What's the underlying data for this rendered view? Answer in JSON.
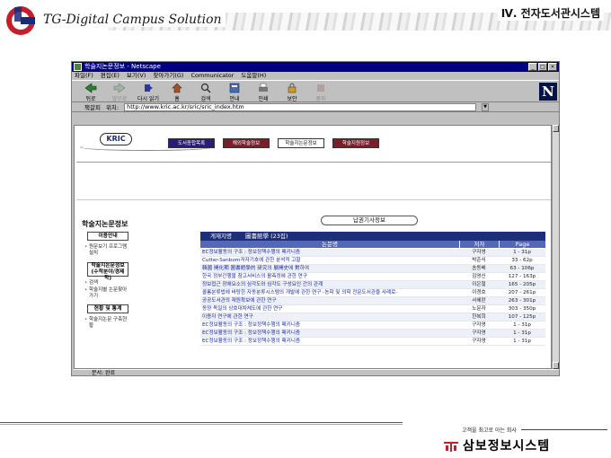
{
  "slide": {
    "title": "Ⅳ. 전자도서관시스템",
    "logo_text": "TG-Digital Campus Solution"
  },
  "footer": {
    "tagline": "고객을 최고로 아는 회사",
    "company": "삼보정보시스템"
  },
  "browser": {
    "title": "학술지논문정보 - Netscape",
    "menu": [
      "파일(F)",
      "편집(E)",
      "보기(V)",
      "찾아가기(G)",
      "Communicator",
      "도움말(H)"
    ],
    "toolbar": [
      {
        "label": "뒤로",
        "icon": "back-icon",
        "enabled": true
      },
      {
        "label": "앞으로",
        "icon": "forward-icon",
        "enabled": false
      },
      {
        "label": "다시 읽기",
        "icon": "reload-icon",
        "enabled": true
      },
      {
        "label": "홈",
        "icon": "home-icon",
        "enabled": true
      },
      {
        "label": "검색",
        "icon": "search-icon",
        "enabled": true
      },
      {
        "label": "안내",
        "icon": "guide-icon",
        "enabled": true
      },
      {
        "label": "인쇄",
        "icon": "print-icon",
        "enabled": true
      },
      {
        "label": "보안",
        "icon": "security-icon",
        "enabled": true
      },
      {
        "label": "중지",
        "icon": "stop-icon",
        "enabled": false
      }
    ],
    "bookmarks_label": "책갈피",
    "location_label": "위치:",
    "url": "http://www.kric.ac.kr/sric/sric_index.htm",
    "status": "문서: 완료"
  },
  "page": {
    "logo": "KRIC",
    "nav": [
      {
        "label": "도서종합목록",
        "color": "#2a1d7a"
      },
      {
        "label": "해외학술정보",
        "color": "#7a1f2a"
      },
      {
        "label": "학술지논문정보",
        "color": "#ffffff"
      },
      {
        "label": "학술지원정보",
        "color": "#7a1f2a"
      }
    ],
    "sidebar": {
      "title": "학술지논문정보",
      "sections": [
        {
          "box": "이용안내",
          "items": [
            "원문보기 프로그램설치"
          ]
        },
        {
          "box": "학술지논문정보 (수학분야/경제학)",
          "items": [
            "검색",
            "학술지별 논문찾아가기"
          ]
        },
        {
          "box": "현황 및 통계",
          "items": [
            "학술지논문 구축현황"
          ]
        }
      ]
    },
    "center_title": "납권기사정보",
    "journal_label": "게재지명",
    "journal_value": "圖書館學 (23집)",
    "columns": {
      "title": "논문명",
      "author": "저자",
      "page": "Page"
    },
    "rows": [
      {
        "title": "EC정보활동의 구조 : 정보정책수행의 패키니즘",
        "author": "구자영",
        "page": "1 - 31p"
      },
      {
        "title": "Cutter-Sanborn저자기호에 관한 분석적 고찰",
        "author": "박준식",
        "page": "33 - 62p"
      },
      {
        "title": "韓國 開化期 圖書館學的 研究의 展開史에 對하여",
        "author": "송동배",
        "page": "63 - 106p"
      },
      {
        "title": "한국 정부간행물 참고서비스의 활측정에 관한 연구",
        "author": "김영신",
        "page": "127 - 163p"
      },
      {
        "title": "정보접근 장애요소의 심각도와 심각도 구성요인 간의 관계",
        "author": "이은철",
        "page": "165 - 205p"
      },
      {
        "title": "콜롬분류법에 바탕한 자동분류시스템의 개발에 관한 연구 -농학 및 의학 전문도서관을 사례로-",
        "author": "이경호",
        "page": "207 - 261p"
      },
      {
        "title": "공공도서관의 재원확보에 관한 연구",
        "author": "서혜란",
        "page": "263 - 301p"
      },
      {
        "title": "동양 독일의 상호대차체도에 관한 연구",
        "author": "노문자",
        "page": "303 - 350p"
      },
      {
        "title": "이용자 연구에 관한 연구",
        "author": "한복희",
        "page": "107 - 125p"
      },
      {
        "title": "EC정보활동의 구조 : 정보정책수행의 패키니즘",
        "author": "구자영",
        "page": "1 - 31p"
      },
      {
        "title": "EC정보활동의 구조 : 정보정책수행의 패키니즘",
        "author": "구자영",
        "page": "1 - 31p"
      },
      {
        "title": "EC정보활동의 구조 : 정보정책수행의 패키니즘",
        "author": "구자영",
        "page": "1 - 31p"
      }
    ]
  }
}
